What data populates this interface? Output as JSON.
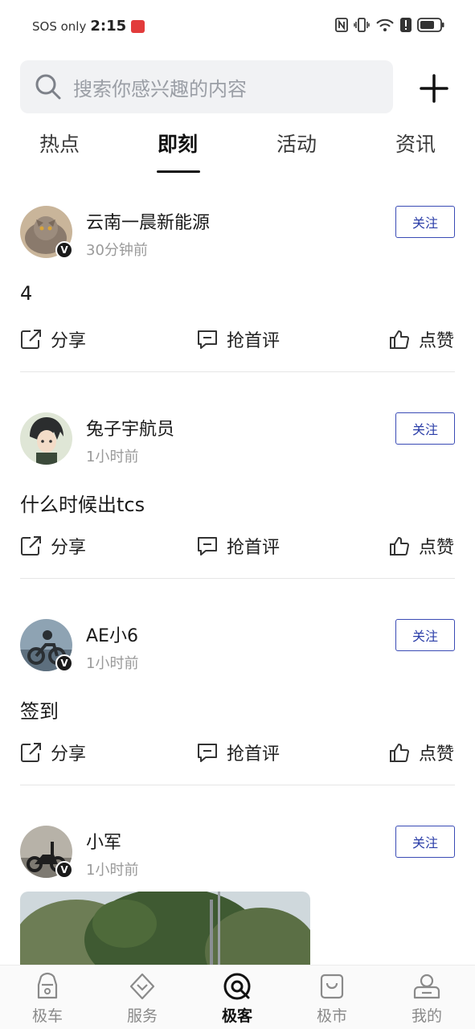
{
  "status_bar": {
    "carrier": "SOS only",
    "time": "2:15",
    "icons": [
      "nfc-icon",
      "vibrate-icon",
      "wifi-icon",
      "alert-icon",
      "battery-icon"
    ]
  },
  "search": {
    "placeholder": "搜索你感兴趣的内容",
    "icon": "search-icon"
  },
  "header": {
    "add_icon": "plus-icon"
  },
  "tabs": [
    {
      "label": "热点"
    },
    {
      "label": "即刻",
      "active": true
    },
    {
      "label": "活动"
    },
    {
      "label": "资讯"
    }
  ],
  "feed": {
    "follow_label": "关注",
    "share_label": "分享",
    "comment_label": "抢首评",
    "like_label": "点赞",
    "verified_mark": "V",
    "posts": [
      {
        "username": "云南一晨新能源",
        "time": "30分钟前",
        "text": "4",
        "verified": true
      },
      {
        "username": "兔子宇航员",
        "time": "1小时前",
        "text": "什么时候出tcs",
        "verified": false
      },
      {
        "username": "AE小6",
        "time": "1小时前",
        "text": "签到",
        "verified": true
      },
      {
        "username": "小军",
        "time": "1小时前",
        "text": "",
        "verified": true
      }
    ]
  },
  "bottom_nav": [
    {
      "label": "极车",
      "icon": "car-icon"
    },
    {
      "label": "服务",
      "icon": "service-icon"
    },
    {
      "label": "极客",
      "icon": "community-icon",
      "active": true
    },
    {
      "label": "极市",
      "icon": "shop-bag-icon"
    },
    {
      "label": "我的",
      "icon": "profile-icon"
    }
  ],
  "colors": {
    "accent": "#2b3ea8",
    "text": "#1a1a1a",
    "muted": "#9a9a9a",
    "search_bg": "#f1f2f4"
  }
}
